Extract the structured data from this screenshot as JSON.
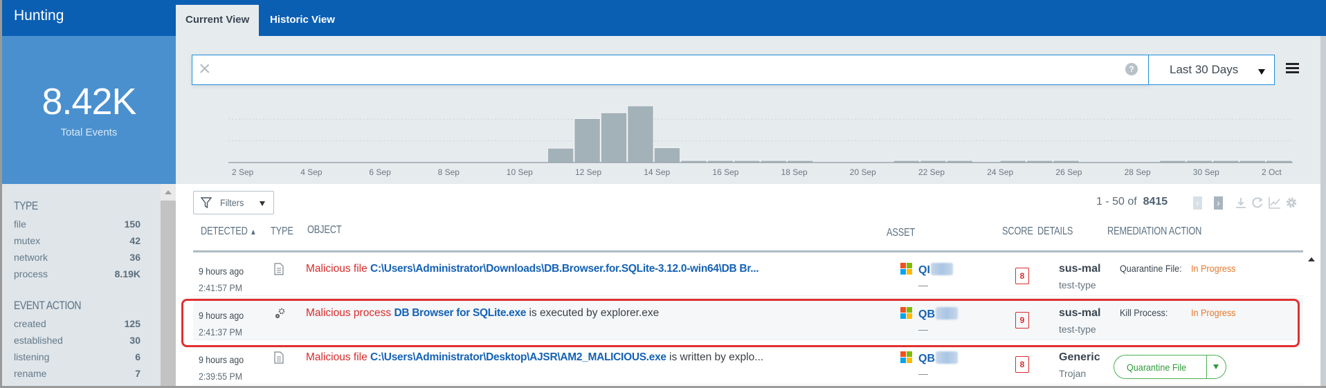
{
  "app": {
    "title": "Hunting"
  },
  "tabs": [
    {
      "label": "Current View",
      "active": true
    },
    {
      "label": "Historic View",
      "active": false
    }
  ],
  "summary": {
    "value": "8.42K",
    "label": "Total Events"
  },
  "facets": [
    {
      "title": "TYPE",
      "items": [
        {
          "label": "file",
          "count": "150"
        },
        {
          "label": "mutex",
          "count": "42"
        },
        {
          "label": "network",
          "count": "36"
        },
        {
          "label": "process",
          "count": "8.19K"
        }
      ]
    },
    {
      "title": "EVENT ACTION",
      "items": [
        {
          "label": "created",
          "count": "125"
        },
        {
          "label": "established",
          "count": "30"
        },
        {
          "label": "listening",
          "count": "6"
        },
        {
          "label": "rename",
          "count": "7"
        }
      ]
    }
  ],
  "search": {
    "value": "",
    "placeholder": "",
    "help_icon": "question-circle-icon",
    "range": "Last 30 Days"
  },
  "chart_data": {
    "type": "bar",
    "title": "",
    "xlabel": "",
    "ylabel": "",
    "grid": true,
    "x_ticks": [
      "2 Sep",
      "4 Sep",
      "6 Sep",
      "8 Sep",
      "10 Sep",
      "12 Sep",
      "14 Sep",
      "16 Sep",
      "18 Sep",
      "20 Sep",
      "22 Sep",
      "24 Sep",
      "26 Sep",
      "28 Sep",
      "30 Sep",
      "2 Oct"
    ],
    "categories": [
      "2 Sep",
      "3 Sep",
      "4 Sep",
      "5 Sep",
      "6 Sep",
      "7 Sep",
      "8 Sep",
      "9 Sep",
      "10 Sep",
      "11 Sep",
      "12 Sep",
      "13 Sep",
      "14 Sep",
      "15 Sep",
      "16 Sep",
      "17 Sep",
      "18 Sep",
      "19 Sep",
      "20 Sep",
      "21 Sep",
      "22 Sep",
      "23 Sep",
      "24 Sep",
      "25 Sep",
      "26 Sep",
      "27 Sep",
      "28 Sep",
      "29 Sep",
      "30 Sep",
      "1 Oct",
      "2 Oct"
    ],
    "values": [
      0,
      0,
      0,
      0,
      0,
      0,
      0,
      0,
      0,
      0,
      0,
      0,
      620,
      1900,
      2150,
      2450,
      640,
      70,
      70,
      70,
      70,
      70,
      0,
      0,
      0,
      60,
      60,
      60,
      0,
      60,
      60,
      60,
      0,
      0,
      0,
      60,
      60,
      60,
      60,
      60
    ],
    "bins_note": "half-day bins approximated",
    "ylim": [
      0,
      2600
    ]
  },
  "toolbar": {
    "filters_label": "Filters",
    "pager_prefix": "1 - 50 of",
    "pager_total": "8415"
  },
  "columns": [
    "DETECTED",
    "TYPE",
    "OBJECT",
    "ASSET",
    "SCORE",
    "DETAILS",
    "REMEDIATION ACTION"
  ],
  "rows": [
    {
      "detected": "9 hours ago",
      "time": "2:41:57 PM",
      "type_icon": "file-icon",
      "prefix": "Malicious file",
      "path": "C:\\Users\\Administrator\\Downloads\\DB.Browser.for.SQLite-3.12.0-win64\\DB Br...",
      "suffix": "",
      "asset": "QI",
      "asset_sub": "—",
      "score": "8",
      "detail": "sus-mal",
      "detail_sub": "test-type",
      "rem_label": "Quarantine File:",
      "rem_status": "In Progress"
    },
    {
      "detected": "9 hours ago",
      "time": "2:41:37 PM",
      "type_icon": "gears-icon",
      "prefix": "Malicious process",
      "path": "DB Browser for SQLite.exe",
      "suffix": "is executed by explorer.exe",
      "asset": "QB",
      "asset_sub": "—",
      "score": "9",
      "detail": "sus-mal",
      "detail_sub": "test-type",
      "rem_label": "Kill Process:",
      "rem_status": "In Progress"
    },
    {
      "detected": "9 hours ago",
      "time": "2:39:55 PM",
      "type_icon": "file-icon",
      "prefix": "Malicious file",
      "path": "C:\\Users\\Administrator\\Desktop\\AJSR\\AM2_MALICIOUS.exe",
      "suffix": "is written by explo...",
      "asset": "QB",
      "asset_sub": "—",
      "score": "8",
      "detail": "Generic",
      "detail_sub": "Trojan",
      "rem_button": "Quarantine File"
    }
  ],
  "colors": {
    "brand": "#0b5fb3",
    "accent": "#1e8ed8",
    "malicious": "#d92b2b",
    "in_progress": "#e8782a",
    "action_green": "#2f9a3a"
  }
}
